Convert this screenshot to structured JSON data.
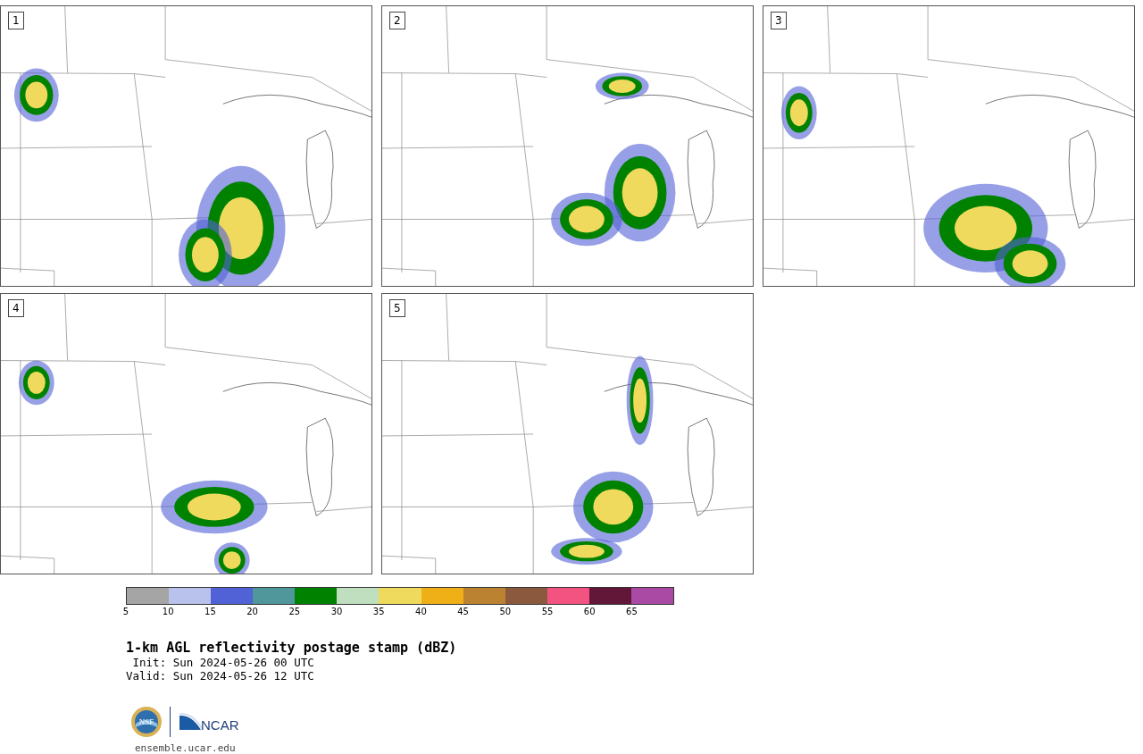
{
  "panels": [
    {
      "label": "1"
    },
    {
      "label": "2"
    },
    {
      "label": "3"
    },
    {
      "label": "4"
    },
    {
      "label": "5"
    }
  ],
  "colorbar": {
    "segments": [
      {
        "color": "#a5a5a5"
      },
      {
        "color": "#b8c2ec"
      },
      {
        "color": "#5161d6"
      },
      {
        "color": "#50979c"
      },
      {
        "color": "#008200"
      },
      {
        "color": "#bfdfbf"
      },
      {
        "color": "#f0da5e"
      },
      {
        "color": "#efaf17"
      },
      {
        "color": "#bb8331"
      },
      {
        "color": "#8b5a3e"
      },
      {
        "color": "#f35380"
      },
      {
        "color": "#621738"
      },
      {
        "color": "#ab4aa5"
      }
    ],
    "ticks": [
      "5",
      "10",
      "15",
      "20",
      "25",
      "30",
      "35",
      "40",
      "45",
      "50",
      "55",
      "60",
      "65"
    ]
  },
  "title": "1-km AGL reflectivity postage stamp (dBZ)",
  "init": " Init: Sun 2024-05-26 00 UTC",
  "valid": "Valid: Sun 2024-05-26 12 UTC",
  "logos": {
    "nsf": "NSF",
    "ncar": "NCAR"
  },
  "site": "ensemble.ucar.edu"
}
